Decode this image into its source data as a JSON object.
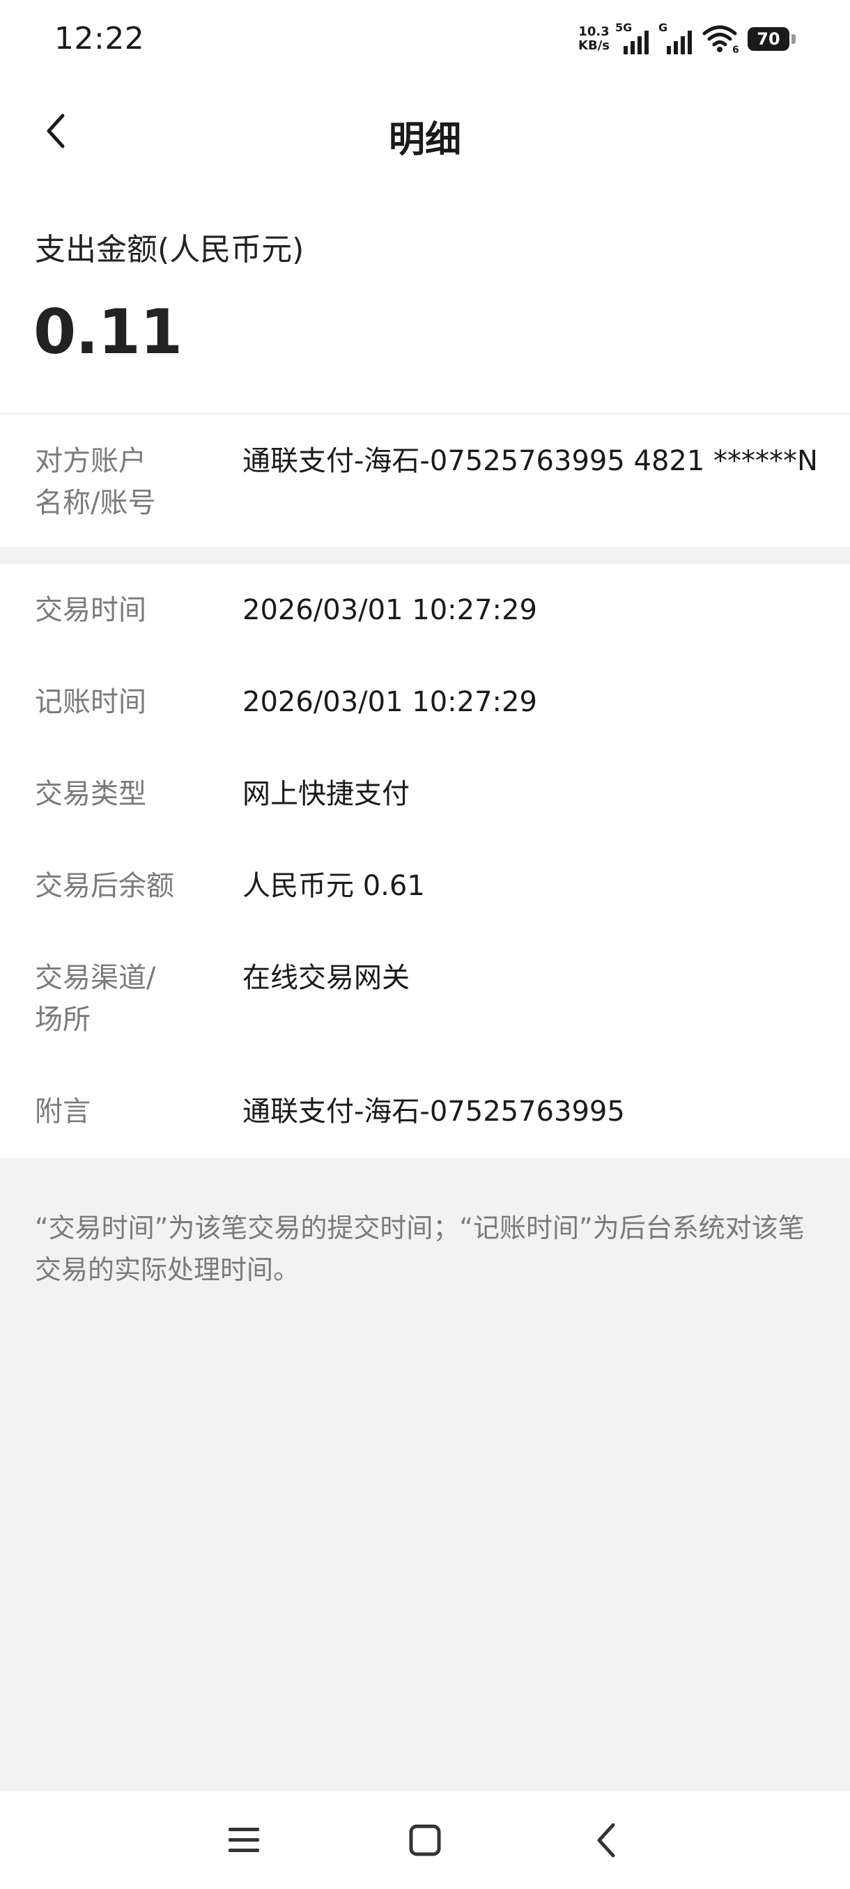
{
  "status_bar": {
    "time": "12:22",
    "net_speed_value": "10.3",
    "net_speed_unit": "KB/s",
    "signal1_label": "5G",
    "signal2_label": "G",
    "wifi_badge": "6",
    "battery_level": "70"
  },
  "header": {
    "title": "明细"
  },
  "amount": {
    "label": "支出金额(人民币元)",
    "value": "0.11"
  },
  "counterparty": {
    "label": "对方账户\n名称/账号",
    "value": "通联支付-海石-07525763995 4821 ******N"
  },
  "details": [
    {
      "label": "交易时间",
      "value": "2026/03/01 10:27:29"
    },
    {
      "label": "记账时间",
      "value": "2026/03/01 10:27:29"
    },
    {
      "label": "交易类型",
      "value": "网上快捷支付"
    },
    {
      "label": "交易后余额",
      "value": "人民币元 0.61"
    },
    {
      "label": "交易渠道/\n场所",
      "value": "在线交易网关"
    },
    {
      "label": "附言",
      "value": "通联支付-海石-07525763995"
    }
  ],
  "note": "“交易时间”为该笔交易的提交时间；“记账时间”为后台系统对该笔交易的实际处理时间。",
  "nav": {
    "icons": [
      "menu-icon",
      "home-icon",
      "back-icon"
    ]
  }
}
